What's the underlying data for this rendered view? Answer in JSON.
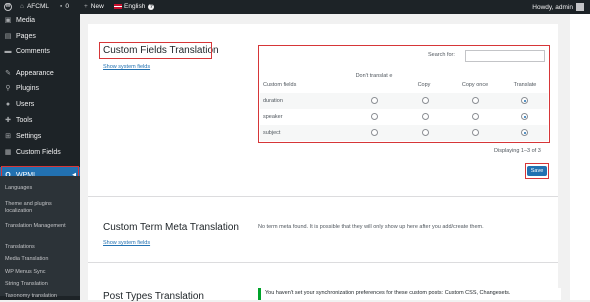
{
  "admin_bar": {
    "site_name": "AFCML",
    "comments_count": "0",
    "new_label": "New",
    "language": "English",
    "greeting": "Howdy, admin"
  },
  "sidebar": {
    "items": [
      {
        "label": "Media",
        "icon": "media-icon"
      },
      {
        "label": "Pages",
        "icon": "pages-icon"
      },
      {
        "label": "Comments",
        "icon": "comments-icon"
      },
      {
        "label": "Appearance",
        "icon": "appearance-icon"
      },
      {
        "label": "Plugins",
        "icon": "plugins-icon"
      },
      {
        "label": "Users",
        "icon": "users-icon"
      },
      {
        "label": "Tools",
        "icon": "tools-icon"
      },
      {
        "label": "Settings",
        "icon": "settings-icon"
      },
      {
        "label": "Custom Fields",
        "icon": "custom-fields-icon"
      }
    ],
    "wpml_label": "WPML",
    "submenu": [
      "Languages",
      "Theme and plugins localization",
      "Translation Management",
      "Translations",
      "Media Translation",
      "WP Menus Sync",
      "String Translation",
      "Taxonomy translation"
    ]
  },
  "custom_fields": {
    "title": "Custom Fields Translation",
    "show_system_fields": "Show system fields",
    "search_label": "Search for:",
    "search_value": "",
    "columns": [
      "Custom fields",
      "Don't translat e",
      "Copy",
      "Copy once",
      "Translate"
    ],
    "rows": [
      {
        "name": "duration",
        "selected": 3
      },
      {
        "name": "speaker",
        "selected": 3
      },
      {
        "name": "subject",
        "selected": 3
      }
    ],
    "displaying": "Displaying 1–3 of 3",
    "save_label": "Save"
  },
  "term_meta": {
    "title": "Custom Term Meta Translation",
    "show_system_fields": "Show system fields",
    "message": "No term meta found. It is possible that they will only show up here after you add/create them."
  },
  "post_types": {
    "title": "Post Types Translation",
    "notice": "You haven't set your synchronization preferences for these custom posts: Custom CSS, Changesets."
  },
  "colors": {
    "accent": "#2271b1",
    "highlight_border": "#d63638",
    "sidebar_bg": "#1d2327"
  }
}
